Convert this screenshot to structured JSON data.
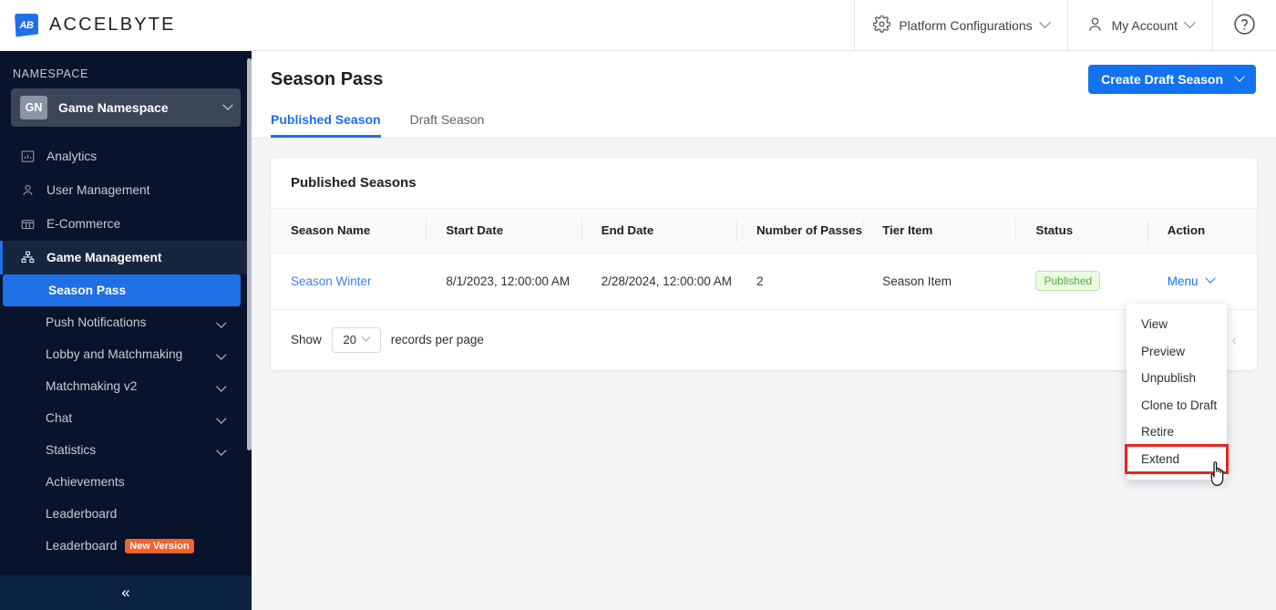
{
  "topbar": {
    "brand_initials": "AB",
    "brand_name": "ACCELBYTE",
    "platform_config_label": "Platform Configurations",
    "account_label": "My Account",
    "help_label": "?"
  },
  "sidebar": {
    "namespace_label": "NAMESPACE",
    "namespace_badge": "GN",
    "namespace_name": "Game Namespace",
    "items": [
      {
        "label": "Analytics",
        "icon": "bar-chart-icon",
        "expandable": false,
        "active": false
      },
      {
        "label": "User Management",
        "icon": "user-icon",
        "expandable": false,
        "active": false
      },
      {
        "label": "E-Commerce",
        "icon": "store-icon",
        "expandable": false,
        "active": false
      },
      {
        "label": "Game Management",
        "icon": "sitemap-icon",
        "expandable": false,
        "active": true
      }
    ],
    "sub_items": [
      {
        "label": "Season Pass",
        "expandable": false,
        "selected": true,
        "badge": ""
      },
      {
        "label": "Push Notifications",
        "expandable": true,
        "selected": false,
        "badge": ""
      },
      {
        "label": "Lobby and Matchmaking",
        "expandable": true,
        "selected": false,
        "badge": ""
      },
      {
        "label": "Matchmaking v2",
        "expandable": true,
        "selected": false,
        "badge": ""
      },
      {
        "label": "Chat",
        "expandable": true,
        "selected": false,
        "badge": ""
      },
      {
        "label": "Statistics",
        "expandable": true,
        "selected": false,
        "badge": ""
      },
      {
        "label": "Achievements",
        "expandable": false,
        "selected": false,
        "badge": ""
      },
      {
        "label": "Leaderboard",
        "expandable": false,
        "selected": false,
        "badge": ""
      },
      {
        "label": "Leaderboard",
        "expandable": false,
        "selected": false,
        "badge": "New Version"
      }
    ],
    "collapse_glyph": "«"
  },
  "main": {
    "page_title": "Season Pass",
    "tabs": [
      {
        "label": "Published Season",
        "active": true
      },
      {
        "label": "Draft Season",
        "active": false
      }
    ],
    "create_button": "Create Draft Season",
    "card_title": "Published Seasons",
    "table": {
      "columns": [
        "Season Name",
        "Start Date",
        "End Date",
        "Number of Passes",
        "Tier Item",
        "Status",
        "Action"
      ],
      "rows": [
        {
          "season_name": "Season Winter",
          "start_date": "8/1/2023, 12:00:00 AM",
          "end_date": "2/28/2024, 12:00:00 AM",
          "number_of_passes": "2",
          "tier_item": "Season Item",
          "status": "Published",
          "action": "Menu"
        }
      ]
    },
    "footer": {
      "show_label": "Show",
      "page_size": "20",
      "records_label": "records per page",
      "prev_glyph": "‹"
    }
  },
  "dropdown": {
    "items": [
      {
        "label": "View",
        "highlight": false
      },
      {
        "label": "Preview",
        "highlight": false
      },
      {
        "label": "Unpublish",
        "highlight": false
      },
      {
        "label": "Clone to Draft",
        "highlight": false
      },
      {
        "label": "Retire",
        "highlight": false
      },
      {
        "label": "Extend",
        "highlight": true
      }
    ]
  },
  "colors": {
    "accent_blue": "#1272f0",
    "sidebar_bg": "#07142b",
    "highlight_red": "#e8251f",
    "status_green": "#54a83c",
    "badge_orange": "#f4622e"
  }
}
